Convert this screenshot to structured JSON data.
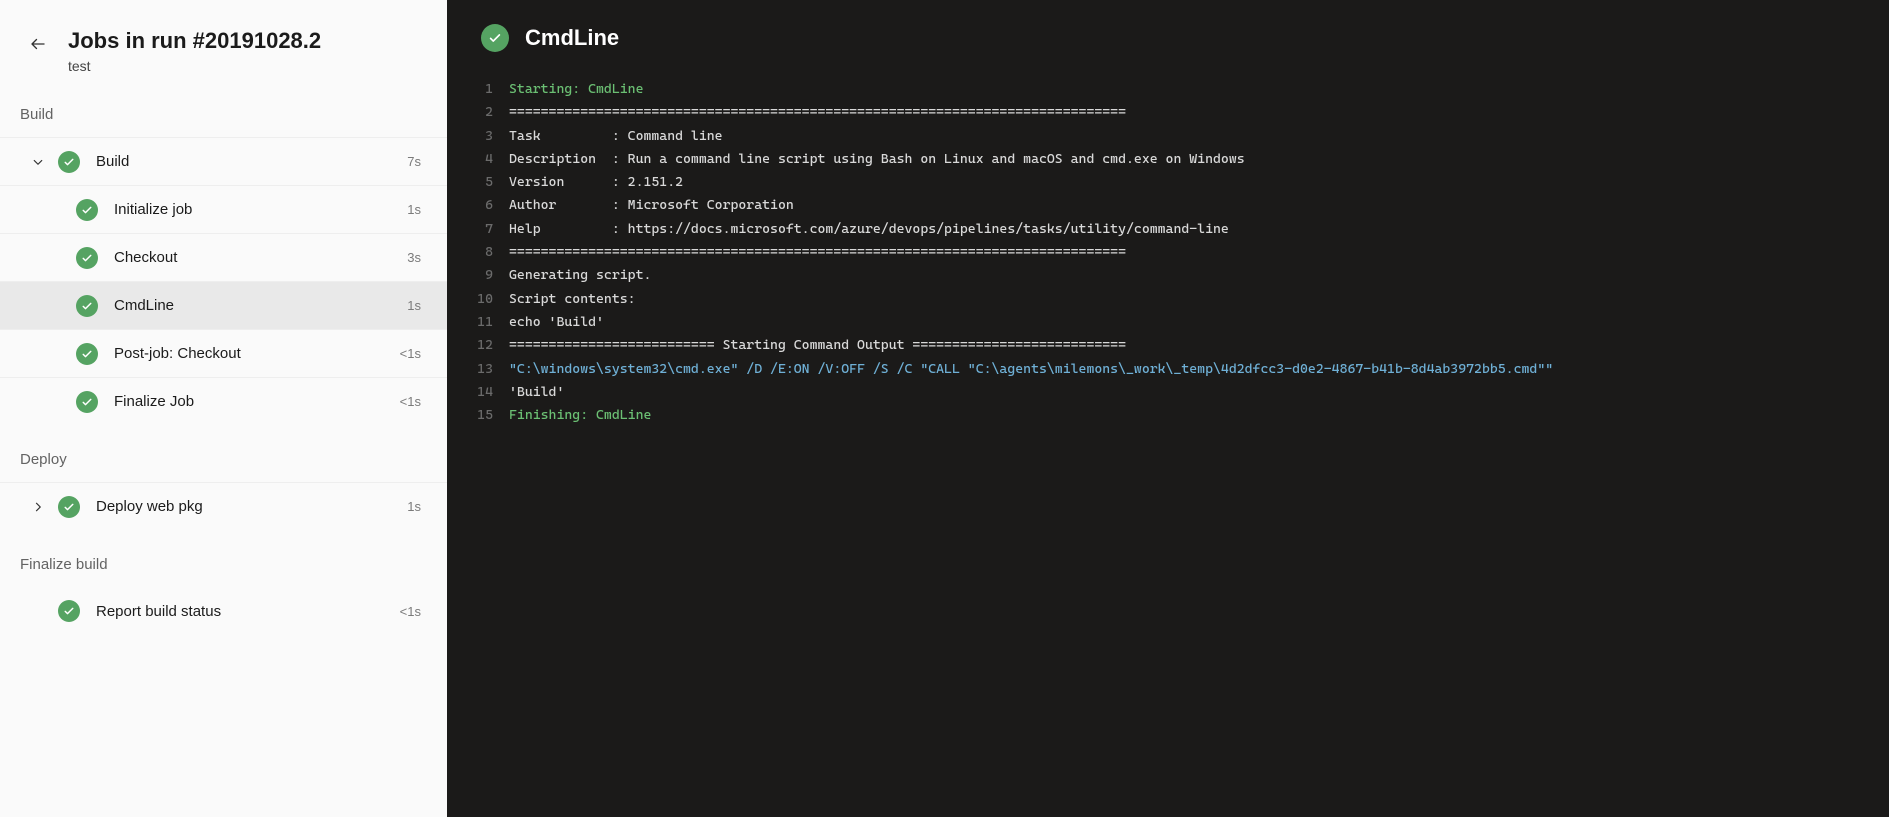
{
  "header": {
    "title": "Jobs in run #20191028.2",
    "subtitle": "test"
  },
  "stages": {
    "build": {
      "label": "Build",
      "job": {
        "label": "Build",
        "duration": "7s",
        "expanded": true
      },
      "steps": [
        {
          "label": "Initialize job",
          "duration": "1s"
        },
        {
          "label": "Checkout",
          "duration": "3s"
        },
        {
          "label": "CmdLine",
          "duration": "1s"
        },
        {
          "label": "Post-job: Checkout",
          "duration": "<1s"
        },
        {
          "label": "Finalize Job",
          "duration": "<1s"
        }
      ]
    },
    "deploy": {
      "label": "Deploy",
      "job": {
        "label": "Deploy web pkg",
        "duration": "1s",
        "expanded": false
      }
    },
    "finalize": {
      "label": "Finalize build",
      "steps": [
        {
          "label": "Report build status",
          "duration": "<1s"
        }
      ]
    }
  },
  "log_panel": {
    "title": "CmdLine",
    "lines": [
      {
        "n": "1",
        "cls": "success",
        "text": "Starting: CmdLine"
      },
      {
        "n": "2",
        "cls": "plain",
        "text": "=============================================================================="
      },
      {
        "n": "3",
        "cls": "plain",
        "text": "Task         : Command line"
      },
      {
        "n": "4",
        "cls": "plain",
        "text": "Description  : Run a command line script using Bash on Linux and macOS and cmd.exe on Windows"
      },
      {
        "n": "5",
        "cls": "plain",
        "text": "Version      : 2.151.2"
      },
      {
        "n": "6",
        "cls": "plain",
        "text": "Author       : Microsoft Corporation"
      },
      {
        "n": "7",
        "cls": "plain",
        "text": "Help         : https://docs.microsoft.com/azure/devops/pipelines/tasks/utility/command-line"
      },
      {
        "n": "8",
        "cls": "plain",
        "text": "=============================================================================="
      },
      {
        "n": "9",
        "cls": "plain",
        "text": "Generating script."
      },
      {
        "n": "10",
        "cls": "plain",
        "text": "Script contents:"
      },
      {
        "n": "11",
        "cls": "plain",
        "text": "echo 'Build'"
      },
      {
        "n": "12",
        "cls": "plain",
        "text": "========================== Starting Command Output ==========================="
      },
      {
        "n": "13",
        "cls": "command",
        "text": "\"C:\\windows\\system32\\cmd.exe\" /D /E:ON /V:OFF /S /C \"CALL \"C:\\agents\\milemons\\_work\\_temp\\4d2dfcc3-d0e2-4867-b41b-8d4ab3972bb5.cmd\"\""
      },
      {
        "n": "14",
        "cls": "plain",
        "text": "'Build'"
      },
      {
        "n": "15",
        "cls": "success",
        "text": "Finishing: CmdLine"
      }
    ]
  }
}
